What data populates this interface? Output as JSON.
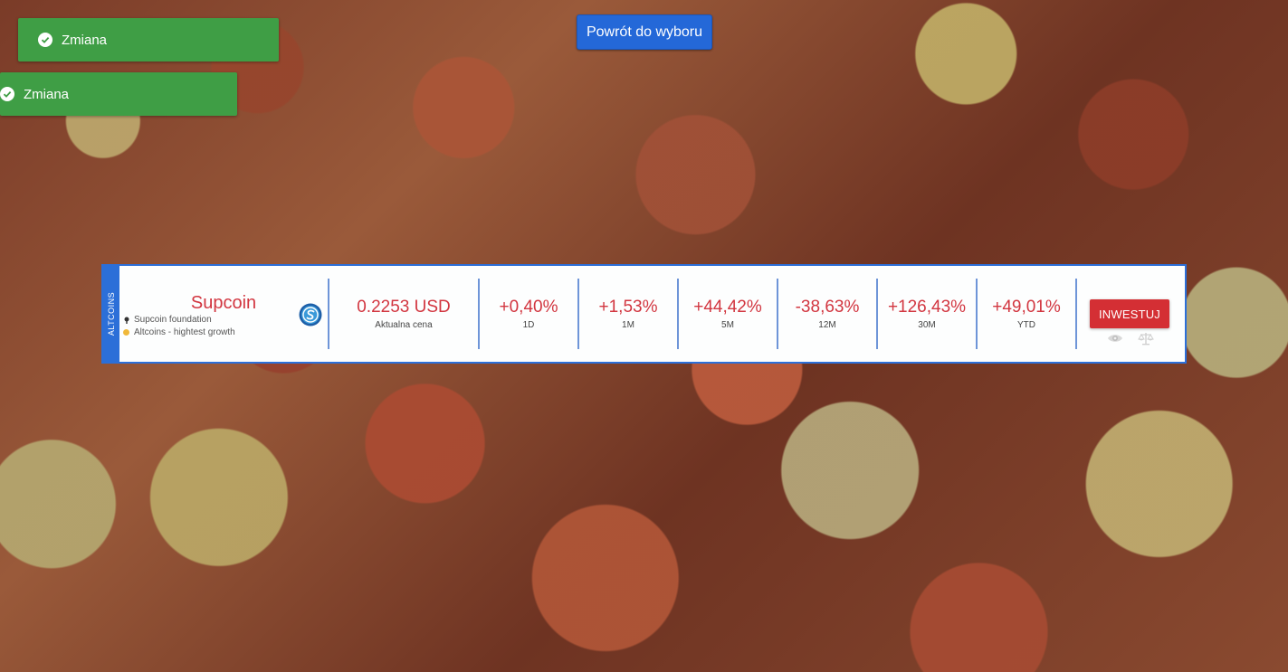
{
  "notifications": [
    {
      "label": "Zmiana",
      "icon": "check-circle-icon"
    },
    {
      "label": "Zmiana",
      "icon": "check-circle-icon"
    }
  ],
  "back_button": {
    "label": "Powrót do wyboru"
  },
  "card": {
    "category_tab": "ALTCOINS",
    "coin": {
      "name": "Supcoin",
      "foundation": "Supcoin foundation",
      "category": "Altcoins - hightest growth",
      "logo_icon": "supcoin-logo-icon"
    },
    "price": {
      "value": "0.2253 USD",
      "label": "Aktualna cena"
    },
    "metrics": [
      {
        "value": "+0,40%",
        "label": "1D"
      },
      {
        "value": "+1,53%",
        "label": "1M"
      },
      {
        "value": "+44,42%",
        "label": "5M"
      },
      {
        "value": "-38,63%",
        "label": "12M"
      },
      {
        "value": "+126,43%",
        "label": "30M"
      },
      {
        "value": "+49,01%",
        "label": "YTD"
      }
    ],
    "invest_button": {
      "label": "INWESTUJ"
    },
    "action_icons": [
      "eye-icon",
      "scale-icon"
    ]
  },
  "colors": {
    "accent_blue": "#2c6fd8",
    "notification_green": "#3f9e45",
    "value_red": "#d23640",
    "invest_red": "#d42f34"
  }
}
